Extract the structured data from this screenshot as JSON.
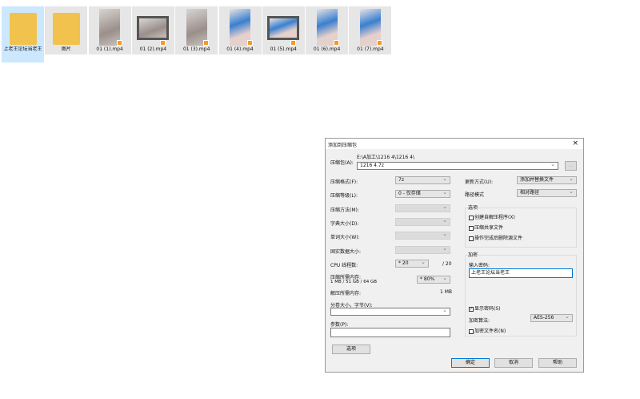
{
  "explorer": {
    "items": [
      {
        "name": "上老王论坛当老王",
        "type": "folder",
        "selected": true
      },
      {
        "name": "图片",
        "type": "folder"
      },
      {
        "name": "01 (1).mp4",
        "type": "video"
      },
      {
        "name": "01 (2).mp4",
        "type": "video"
      },
      {
        "name": "01 (3).mp4",
        "type": "video"
      },
      {
        "name": "01 (4).mp4",
        "type": "video"
      },
      {
        "name": "01 (5).mp4",
        "type": "video"
      },
      {
        "name": "01 (6).mp4",
        "type": "video"
      },
      {
        "name": "01 (7).mp4",
        "type": "video"
      }
    ]
  },
  "dialog": {
    "title": "添加到压缩包",
    "close": "×",
    "archive_label": "压缩包(A):",
    "archive_path": "E:\\A加工\\1216 4\\1216 4\\",
    "archive_name": "1216 4.7z",
    "browse": "...",
    "format_label": "压缩格式(F):",
    "format": "7z",
    "level_label": "压缩等级(L):",
    "level": "0 - 仅存储",
    "method_label": "压缩方法(M):",
    "dict_label": "字典大小(D):",
    "word_label": "单词大小(W):",
    "solid_label": "固实数据大小:",
    "cpu_label": "CPU 线程数:",
    "cpu": "* 20",
    "cpu_max": "/ 20",
    "mem_label": "压缩所需内存:",
    "mem_value": "1 MB / 51 GB / 64 GB",
    "mem_pct": "* 80%",
    "decomp_label": "解压所需内存:",
    "decomp_value": "1 MB",
    "split_label": "分卷大小，字节(V):",
    "split": "",
    "params_label": "参数(P):",
    "params": "",
    "options_button": "选项",
    "update_label": "更新方式(U):",
    "update": "添加并替换文件",
    "path_label": "路径模式",
    "path": "相对路径",
    "options_group": "选项",
    "opt_sfx": "创建自解压程序(X)",
    "opt_shared": "压缩共享文件",
    "opt_delete": "操作完成后删除源文件",
    "enc_group": "加密",
    "pwd_label": "输入密码:",
    "password": "上老王论坛当老王",
    "show_pwd": "显示密码(S)",
    "show_pwd_checked": true,
    "enc_method_label": "加密算法:",
    "enc_method": "AES-256",
    "enc_names": "加密文件名(N)",
    "ok": "确定",
    "cancel": "取消",
    "help": "帮助"
  }
}
